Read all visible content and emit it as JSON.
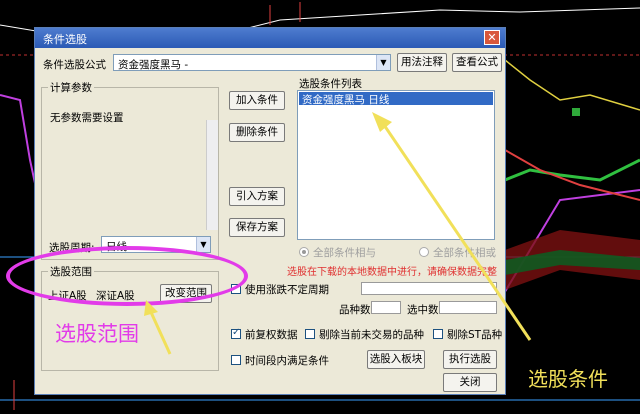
{
  "dialog": {
    "title": "条件选股",
    "close_glyph": "✕",
    "formula_label": "条件选股公式",
    "formula_value": "资金强度黑马 -",
    "btn_usage": "用法注释",
    "btn_view": "查看公式",
    "params_group": "计算参数",
    "params_text": "无参数需要设置",
    "period_label": "选股周期:",
    "period_value": "日线",
    "range_group": "选股范围",
    "range_items": [
      "上证A股",
      "深证A股"
    ],
    "btn_change_range": "改变范围",
    "btn_add": "加入条件",
    "btn_delete": "删除条件",
    "btn_import": "引入方案",
    "btn_save": "保存方案",
    "list_title": "选股条件列表",
    "list_items": [
      "资金强度黑马  日线"
    ],
    "radio_and": "全部条件相与",
    "radio_or": "全部条件相或",
    "warning": "选股在下载的本地数据中进行，请确保数据完整",
    "opt_unfixed": "使用涨跌不定周期",
    "count_label": "品种数",
    "selected_label": "选中数",
    "opt_fq": "前复权数据",
    "opt_exclude_untraded": "剔除当前未交易的品种",
    "opt_exclude_st": "剔除ST品种",
    "opt_time": "时间段内满足条件",
    "btn_to_block": "选股入板块",
    "btn_execute": "执行选股",
    "btn_close": "关闭"
  },
  "annotations": {
    "range_note": "选股范围",
    "condition_note": "选股条件"
  },
  "colors": {
    "title_bar": "#2b5ab5",
    "selection": "#316ac5",
    "warning": "#e03030",
    "annotation_pink": "#e23be9",
    "annotation_yellow": "#f1e05a"
  }
}
